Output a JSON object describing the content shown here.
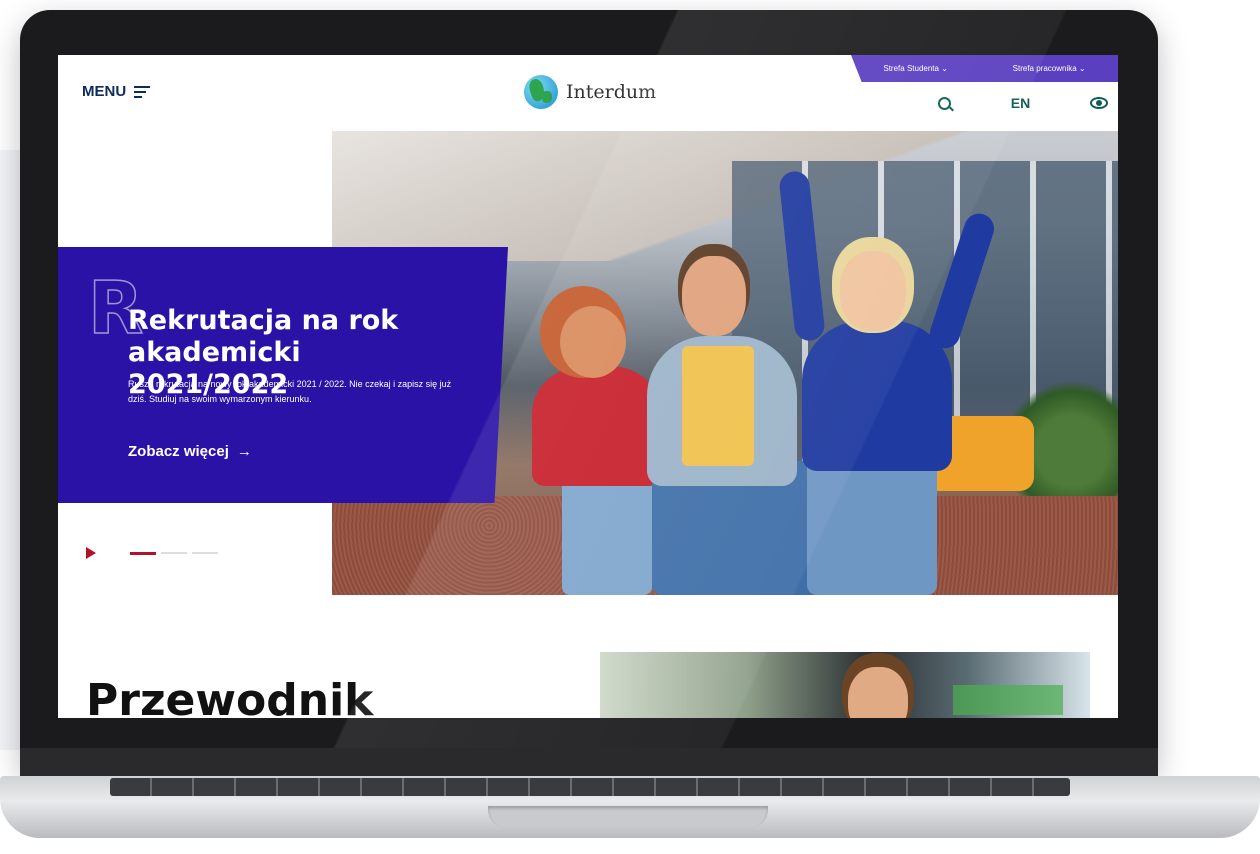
{
  "header": {
    "menu_label": "MENU",
    "logo_text": "Interdum",
    "topbar": {
      "student_zone": "Strefa Studenta ⌄",
      "staff_zone": "Strefa pracownika ⌄"
    },
    "lang": "EN"
  },
  "hero": {
    "decor_letter": "R",
    "title": "Rekrutacja na rok akademicki 2021/2022",
    "description": "Rusza rekrutacja na nowy rok akademicki 2021 / 2022. Nie czekaj i zapisz się już dziś. Studiuj na swoim wymarzonym kierunku.",
    "cta": "Zobacz więcej",
    "cta_arrow": "→",
    "slides_total": 3,
    "slide_active": 1
  },
  "guide": {
    "title": "Przewodnik"
  },
  "colors": {
    "hero_card": "#2a12a6",
    "topbar": "#5a3fc0",
    "accent": "#b3102a",
    "icon": "#0f5c50"
  },
  "icons": [
    "hamburger-icon",
    "globe-logo-icon",
    "search-icon",
    "eye-icon",
    "arrow-right-icon",
    "play-icon"
  ]
}
